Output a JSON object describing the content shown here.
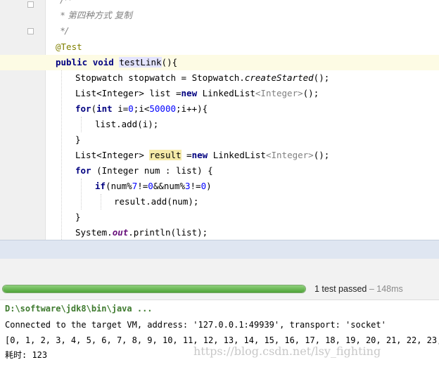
{
  "editor": {
    "top_fragment": "/**",
    "comment_line": "* 第四种方式 复制",
    "comment_end": "*/",
    "annotation": "@Test",
    "sig_public": "public",
    "sig_void": "void",
    "method_name": "testLink",
    "sig_rest": "(){",
    "l1": "Stopwatch stopwatch = Stopwatch.",
    "l1_method": "createStarted",
    "l1_end": "();",
    "l2_a": "List",
    "l2_gen": "<Integer>",
    "l2_b": " list =",
    "kw_new": "new",
    "l2_c": " LinkedList",
    "l2_gen2": "<Integer>",
    "l2_end": "();",
    "kw_for": "for",
    "kw_int": "int",
    "l3_a": "(",
    "l3_b": " i=",
    "l3_zero": "0",
    "l3_c": ";i<",
    "l3_limit": "50000",
    "l3_d": ";i++){",
    "l4": "list.add(i);",
    "brace": "}",
    "l6_a": "List",
    "l6_gen": "<Integer>",
    "l6_var": "result",
    "l6_b": " =",
    "l6_c": " LinkedList",
    "l6_gen2": "<Integer>",
    "l6_end": "();",
    "l7_rest": " (Integer num : list) {",
    "kw_if": "if",
    "l8_a": "(num%",
    "l8_n7": "7",
    "l8_b": "!=",
    "l8_z1": "0",
    "l8_c": "&&num%",
    "l8_n3": "3",
    "l8_d": "!=",
    "l8_z2": "0",
    "l8_e": ")",
    "l9": "result.add(num);",
    "l11_a": "System.",
    "l11_out": "out",
    "l11_b": ".println(list);"
  },
  "test_run": {
    "progress": 1.0,
    "status": "1 test passed",
    "duration": "– 148ms"
  },
  "console": {
    "command": "D:\\software\\jdk8\\bin\\java ...",
    "connected": "Connected to the target VM, address: '127.0.0.1:49939', transport: 'socket'",
    "output_list": "[0, 1, 2, 3, 4, 5, 6, 7, 8, 9, 10, 11, 12, 13, 14, 15, 16, 17, 18, 19, 20, 21, 22, 23, 2",
    "elapsed": "耗时: 123"
  },
  "watermark": "https://blog.csdn.net/lsy_fighting",
  "colors": {
    "keyword": "#000080",
    "annotation": "#808000",
    "number": "#0000ff",
    "progress": "#4ea337"
  },
  "icons": [
    "run-test-icon",
    "fold-marker-icon"
  ]
}
